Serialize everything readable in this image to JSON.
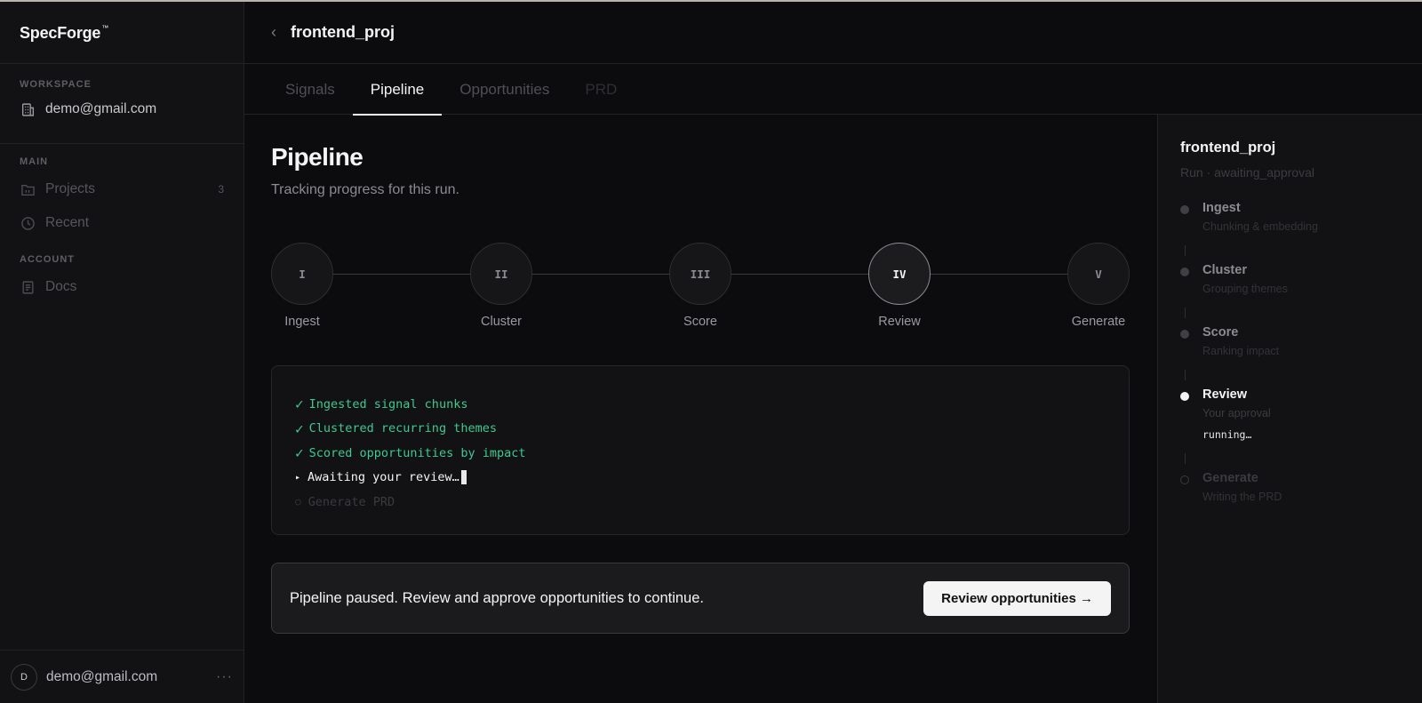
{
  "brand": {
    "name": "SpecForge",
    "tm": "™"
  },
  "sidebar": {
    "workspace_label": "WORKSPACE",
    "workspace_email": "demo@gmail.com",
    "main_label": "MAIN",
    "items": [
      {
        "label": "Projects",
        "count": "3",
        "icon": "folder-icon"
      },
      {
        "label": "Recent",
        "icon": "clock-icon"
      }
    ],
    "account_label": "ACCOUNT",
    "account_items": [
      {
        "label": "Docs",
        "icon": "document-icon"
      }
    ],
    "footer": {
      "avatar_initial": "D",
      "email": "demo@gmail.com",
      "more": "···"
    }
  },
  "header": {
    "back": "‹",
    "title": "frontend_proj"
  },
  "tabs": [
    {
      "label": "Signals",
      "state": "inactive"
    },
    {
      "label": "Pipeline",
      "state": "active"
    },
    {
      "label": "Opportunities",
      "state": "inactive"
    },
    {
      "label": "PRD",
      "state": "disabled"
    }
  ],
  "main": {
    "title": "Pipeline",
    "subtitle": "Tracking progress for this run.",
    "steps": [
      {
        "numeral": "I",
        "label": "Ingest"
      },
      {
        "numeral": "II",
        "label": "Cluster"
      },
      {
        "numeral": "III",
        "label": "Score"
      },
      {
        "numeral": "IV",
        "label": "Review",
        "current": true
      },
      {
        "numeral": "V",
        "label": "Generate"
      }
    ],
    "log": [
      {
        "mark": "✓",
        "text": "Ingested signal chunks",
        "state": "done"
      },
      {
        "mark": "✓",
        "text": "Clustered recurring themes",
        "state": "done"
      },
      {
        "mark": "✓",
        "text": "Scored opportunities by impact",
        "state": "done"
      },
      {
        "mark": "▸",
        "text": "Awaiting your review…",
        "state": "active"
      },
      {
        "mark": "○",
        "text": "Generate PRD",
        "state": "pending"
      }
    ],
    "banner": {
      "text": "Pipeline paused. Review and approve opportunities to continue.",
      "button": "Review opportunities →"
    }
  },
  "panel": {
    "title": "frontend_proj",
    "meta": "Run · awaiting_approval",
    "stages": [
      {
        "name": "Ingest",
        "desc": "Chunking & embedding",
        "state": "done"
      },
      {
        "name": "Cluster",
        "desc": "Grouping themes",
        "state": "done"
      },
      {
        "name": "Score",
        "desc": "Ranking impact",
        "state": "done"
      },
      {
        "name": "Review",
        "desc": "Your approval",
        "state": "current",
        "status": "running…"
      },
      {
        "name": "Generate",
        "desc": "Writing the PRD",
        "state": "pending"
      }
    ]
  },
  "colors": {
    "accent_green": "#3ec98f",
    "background": "#0c0c0e",
    "panel": "#121214"
  }
}
